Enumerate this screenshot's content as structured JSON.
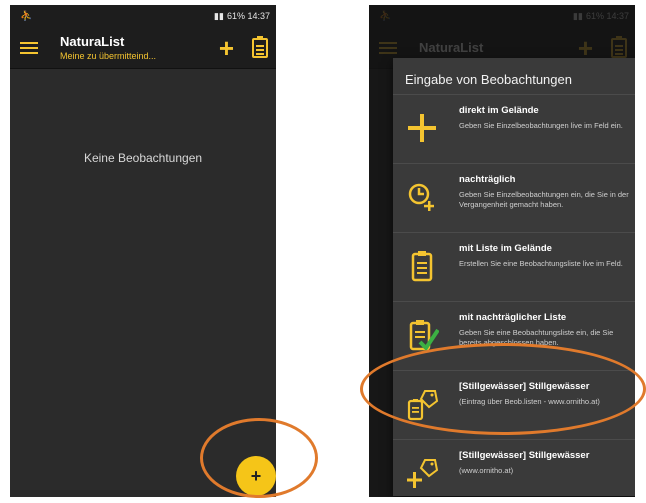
{
  "status_bar": {
    "left_icon": "person-icon",
    "right_text": "61% 14:37"
  },
  "app_bar": {
    "title": "NaturaList",
    "subtitle": "Meine zu übermitteind..."
  },
  "left_screen": {
    "empty_message": "Keine Beobachtungen",
    "fab_label": "+"
  },
  "dialog": {
    "title": "Eingabe von Beobachtungen",
    "options": [
      {
        "title": "direkt im Gelände",
        "desc": "Geben Sie Einzelbeobachtungen live im Feld ein.",
        "icon": "plus-icon"
      },
      {
        "title": "nachträglich",
        "desc": "Geben Sie Einzelbeobachtungen ein, die Sie in der Vergangenheit gemacht haben.",
        "icon": "clock-plus-icon"
      },
      {
        "title": "mit Liste im Gelände",
        "desc": "Erstellen Sie eine Beobachtungsliste live im Feld.",
        "icon": "clipboard-icon"
      },
      {
        "title": "mit nachträglicher Liste",
        "desc": "Geben Sie eine Beobachtungsliste ein, die Sie bereits abgeschlossen haben.",
        "icon": "clipboard-check-icon"
      },
      {
        "title": "[Stillgewässer] Stillgewässer",
        "desc": "(Eintrag über Beob.listen - www.ornitho.at)",
        "icon": "clipboard-tag-icon"
      },
      {
        "title": "[Stillgewässer] Stillgewässer",
        "desc": "(www.ornitho.at)",
        "icon": "plus-tag-icon"
      }
    ]
  },
  "colors": {
    "accent": "#f4c430",
    "highlight": "#e07a2c",
    "background": "#2b2b2b"
  }
}
